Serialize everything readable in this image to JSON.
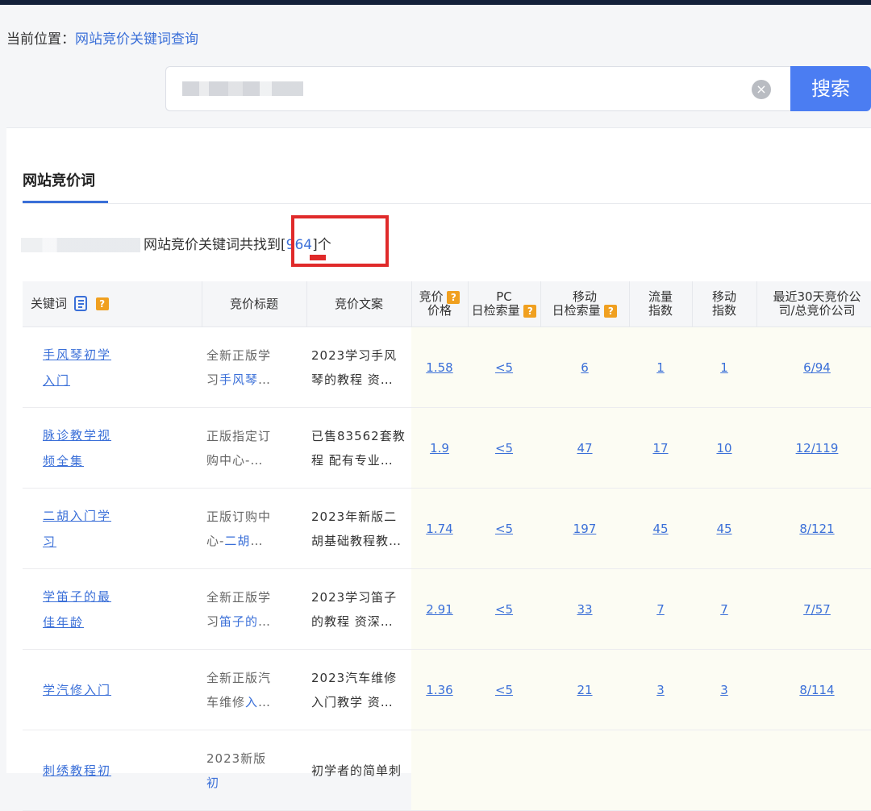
{
  "breadcrumb": {
    "prefix": "当前位置：",
    "current": "网站竞价关键词查询"
  },
  "search": {
    "button_label": "搜索",
    "clear_icon": "×"
  },
  "panel": {
    "title": "网站竞价词"
  },
  "summary": {
    "text_before": "网站竞价关键词共找到",
    "open": "[",
    "count": "964",
    "close": "]",
    "unit": "个"
  },
  "table": {
    "headers": {
      "keyword": "关键词",
      "title": "竞价标题",
      "copy": "竞价文案",
      "price_1": "竞价",
      "price_2": "价格",
      "pc_1": "PC",
      "pc_2": "日检索量",
      "mobile_1": "移动",
      "mobile_2": "日检索量",
      "traffic_1": "流量",
      "traffic_2": "指数",
      "mindex_1": "移动",
      "mindex_2": "指数",
      "recent_1": "最近30天竞价公",
      "recent_2": "司/总竞价公司"
    },
    "rows": [
      {
        "kw1": "手风琴初学",
        "kw2": "入门",
        "t1": "全新正版学",
        "t2a": "习",
        "t2b": "手风琴",
        "t2c": "…",
        "c1": "2023学习手风",
        "c2": "琴的教程 资…",
        "price": "1.58",
        "pc": "<5",
        "mobile": "6",
        "traffic": "1",
        "mindex": "1",
        "recent": "6/94"
      },
      {
        "kw1": "脉诊教学视",
        "kw2": "频全集",
        "t1": "正版指定订",
        "t2a": "购中心-…",
        "t2b": "",
        "t2c": "",
        "c1": "已售83562套教",
        "c2": "程 配有专业…",
        "price": "1.9",
        "pc": "<5",
        "mobile": "47",
        "traffic": "17",
        "mindex": "10",
        "recent": "12/119"
      },
      {
        "kw1": "二胡入门学",
        "kw2": "习",
        "t1": "正版订购中",
        "t2a": "心-",
        "t2b": "二胡",
        "t2c": "…",
        "c1": "2023年新版二",
        "c2": "胡基础教程教…",
        "price": "1.74",
        "pc": "<5",
        "mobile": "197",
        "traffic": "45",
        "mindex": "45",
        "recent": "8/121"
      },
      {
        "kw1": "学笛子的最",
        "kw2": "佳年龄",
        "t1": "全新正版学",
        "t2a": "习",
        "t2b": "笛子的",
        "t2c": "…",
        "c1": "2023学习笛子",
        "c2": "的教程 资深…",
        "price": "2.91",
        "pc": "<5",
        "mobile": "33",
        "traffic": "7",
        "mindex": "7",
        "recent": "7/57"
      },
      {
        "kw1": "学汽修入门",
        "kw2": "",
        "t1": "全新正版汽",
        "t2a": "车维修",
        "t2b": "入",
        "t2c": "…",
        "c1": "2023汽车维修",
        "c2": "入门教学 资…",
        "price": "1.36",
        "pc": "<5",
        "mobile": "21",
        "traffic": "3",
        "mindex": "3",
        "recent": "8/114"
      },
      {
        "kw1": "刺绣教程初",
        "kw2": "",
        "t1": "2023新版",
        "t2a": "",
        "t2b": "初",
        "t2c": "",
        "c1": "初学者的简单刺",
        "c2": "",
        "price": "",
        "pc": "",
        "mobile": "",
        "traffic": "",
        "mindex": "",
        "recent": ""
      }
    ]
  }
}
